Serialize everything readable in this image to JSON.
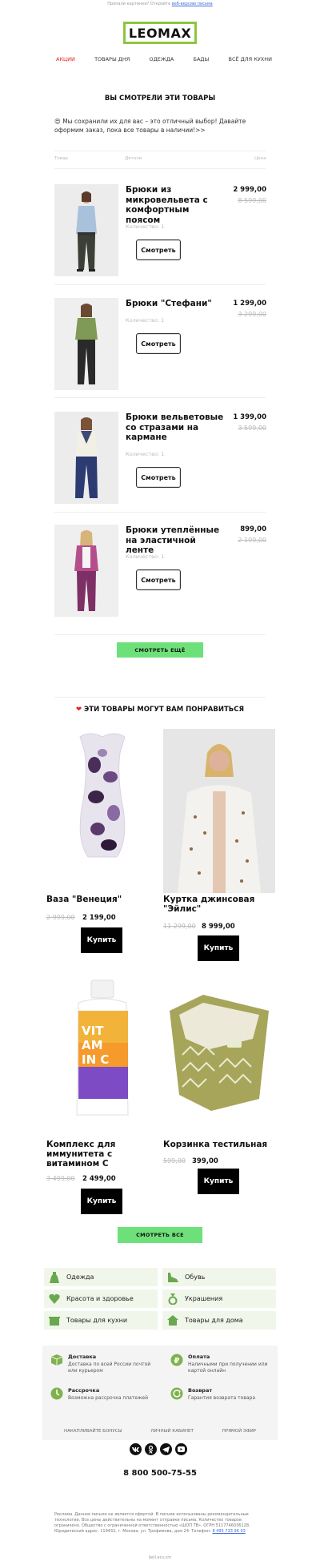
{
  "preheader": {
    "text": "Пропали картинки? Откройте",
    "link": "веб-версию письма"
  },
  "logo": "LEOMAX",
  "nav": [
    "АКЦИИ",
    "ТОВАРЫ ДНЯ",
    "ОДЕЖДА",
    "БАДЫ",
    "ВСЁ ДЛЯ КУХНИ"
  ],
  "viewed": {
    "title": "ВЫ СМОТРЕЛИ ЭТИ ТОВАРЫ",
    "intro": "😍 Мы сохранили их для вас – это отличный выбор! Давайте оформим заказ, пока все товары в наличии!>>",
    "col_product": "Товар",
    "col_details": "Детали",
    "col_price": "Цена",
    "view_label": "Смотреть",
    "items": [
      {
        "name": "Брюки из микровельвета с комфортным поясом",
        "qty": "Количество: 1",
        "price": "2 999,00",
        "old_price": "8 599,00"
      },
      {
        "name": "Брюки \"Стефани\"",
        "qty": "Количество: 1",
        "price": "1 299,00",
        "old_price": "3 299,00"
      },
      {
        "name": "Брюки вельветовые со стразами на кармане",
        "qty": "Количество: 1",
        "price": "1 399,00",
        "old_price": "3 599,00"
      },
      {
        "name": "Брюки утеплённые на эластичной ленте",
        "qty": "Количество: 1",
        "price": "899,00",
        "old_price": "2 199,00"
      }
    ],
    "more_button": "СМОТРЕТЬ ЕЩЁ"
  },
  "recommend": {
    "title": "ЭТИ ТОВАРЫ МОГУТ ВАМ ПОНРАВИТЬСЯ",
    "buy_label": "Купить",
    "items": [
      {
        "name": "Ваза \"Венеция\"",
        "old_price": "2 999,00",
        "price": "2 199,00"
      },
      {
        "name": "Куртка джинсовая \"Эйлис\"",
        "old_price": "11 299,00",
        "price": "8 999,00"
      },
      {
        "name": "Комплекс для иммунитета с витамином С",
        "old_price": "3 499,00",
        "price": "2 499,00"
      },
      {
        "name": "Корзинка тестильная",
        "old_price": "599,00",
        "price": "399,00"
      }
    ],
    "all_button": "СМОТРЕТЬ ВСЕ"
  },
  "categories": [
    {
      "label": "Одежда",
      "icon": "dress-icon"
    },
    {
      "label": "Обувь",
      "icon": "shoe-icon"
    },
    {
      "label": "Красота и здоровье",
      "icon": "heart-icon"
    },
    {
      "label": "Украшения",
      "icon": "ring-icon"
    },
    {
      "label": "Товары для кухни",
      "icon": "pot-icon"
    },
    {
      "label": "Товары для дома",
      "icon": "house-icon"
    }
  ],
  "info": [
    {
      "title": "Доставка",
      "text": "Доставка по всей России почтой или курьером",
      "icon": "box-icon"
    },
    {
      "title": "Оплата",
      "text": "Наличными при получении или картой онлайн",
      "icon": "ruble-icon"
    },
    {
      "title": "Рассрочка",
      "text": "Возможна рассрочка платежей",
      "icon": "clock-icon"
    },
    {
      "title": "Возврат",
      "text": "Гарантия возврата товара",
      "icon": "return-icon"
    }
  ],
  "footer_links": [
    "НАКАПЛИВАЙТЕ БОНУСЫ",
    "ЛИЧНЫЙ КАБИНЕТ",
    "ПРЯМОЙ ЭФИР"
  ],
  "socials": [
    "vk-icon",
    "ok-icon",
    "telegram-icon",
    "youtube-icon"
  ],
  "phone": "8 800 500-75-55",
  "legal": {
    "text": "Реклама. Данное письмо не является офертой. В письме использованы рекомендательные технологии. Все цены действительны на момент отправки письма. Количество товаров ограничено. Общество с ограниченной ответственностью «ШОП ТВ», ОГРН 5117746036128. Юридический адрес: 119432, г. Москва, ул. Трофимова, дом 24. Телефон:",
    "phone_link": "8 495 733 96 03"
  },
  "domain": "bell.ecv.cm",
  "colors": {
    "accent_green": "#6ee07a",
    "logo_green": "#8dc63f",
    "active_red": "#e2231a",
    "category_bg": "#f1f6ea"
  }
}
